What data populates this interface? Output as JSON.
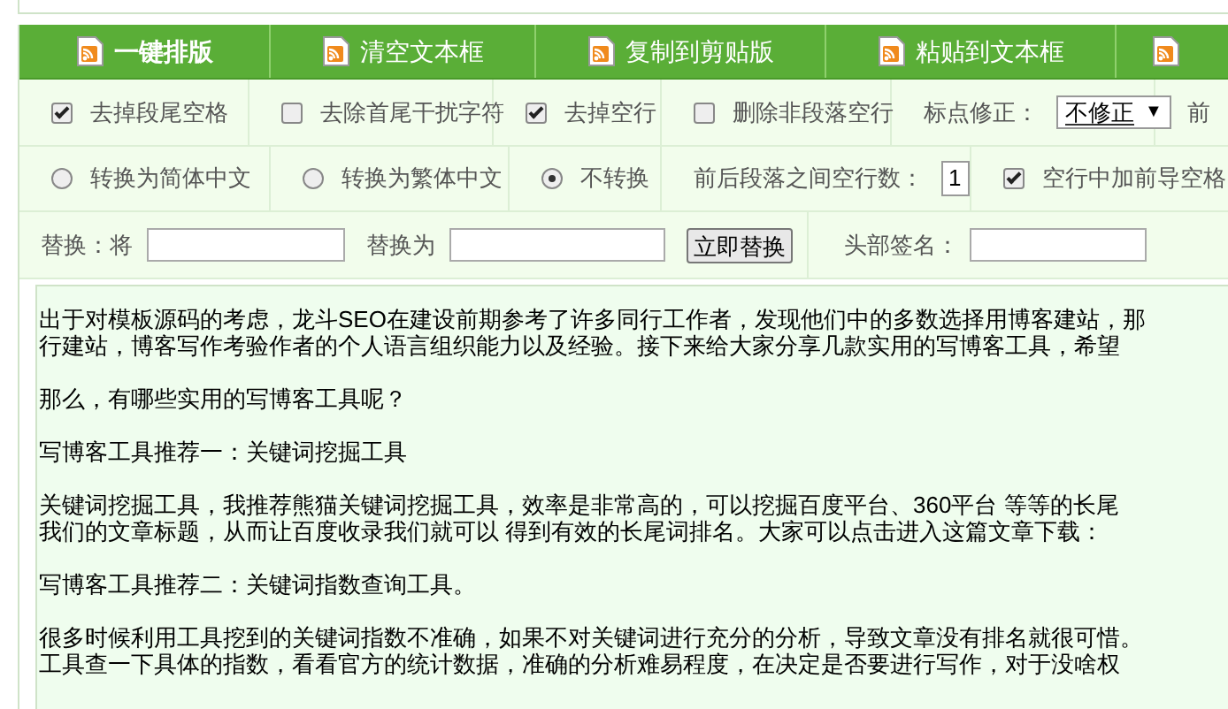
{
  "toolbar": [
    {
      "kind": "primary",
      "label": "一键排版"
    },
    {
      "kind": "normal",
      "label": "清空文本框"
    },
    {
      "kind": "normal",
      "label": "复制到剪贴版"
    },
    {
      "kind": "normal",
      "label": "粘贴到文本框"
    },
    {
      "kind": "icon_only"
    }
  ],
  "options_row": [
    {
      "kind": "checkbox",
      "label": "去掉段尾空格",
      "checked": true
    },
    {
      "kind": "checkbox",
      "label": "去除首尾干扰字符",
      "checked": false
    },
    {
      "kind": "checkbox",
      "label": "去掉空行",
      "checked": true
    },
    {
      "kind": "checkbox",
      "label": "删除非段落空行",
      "checked": false
    },
    {
      "kind": "select",
      "label": "标点修正：",
      "value": "不修正",
      "arrow": "▼"
    },
    {
      "kind": "text",
      "label": "前"
    }
  ],
  "convert_row": [
    {
      "kind": "radio",
      "label": "转换为简体中文",
      "selected": false
    },
    {
      "kind": "radio",
      "label": "转换为繁体中文",
      "selected": false
    },
    {
      "kind": "radio",
      "label": "不转换",
      "selected": true
    },
    {
      "kind": "number",
      "label": "前后段落之间空行数：",
      "value": "1"
    },
    {
      "kind": "checkbox",
      "label": "空行中加前导空格",
      "checked": true
    }
  ],
  "replace_row": {
    "find_label": "替换：将",
    "replace_label": "替换为",
    "button": "立即替换",
    "signature_label": "头部签名："
  },
  "text": [
    {
      "lines": [
        "出于对模板源码的考虑，龙斗SEO在建设前期参考了许多同行工作者，发现他们中的多数选择用博客建站，那",
        "行建站，博客写作考验作者的个人语言组织能力以及经验。接下来给大家分享几款实用的写博客工具，希望"
      ]
    },
    {
      "lines": [
        "那么，有哪些实用的写博客工具呢？"
      ]
    },
    {
      "lines": [
        "写博客工具推荐一：关键词挖掘工具"
      ]
    },
    {
      "lines": [
        "关键词挖掘工具，我推荐熊猫关键词挖掘工具，效率是非常高的，可以挖掘百度平台、360平台 等等的长尾",
        "我们的文章标题，从而让百度收录我们就可以 得到有效的长尾词排名。大家可以点击进入这篇文章下载："
      ]
    },
    {
      "lines": [
        "写博客工具推荐二：关键词指数查询工具。"
      ]
    },
    {
      "lines": [
        "很多时候利用工具挖到的关键词指数不准确，如果不对关键词进行充分的分析，导致文章没有排名就很可惜。",
        "工具查一下具体的指数，看看官方的统计数据，准确的分析难易程度，在决定是否要进行写作，对于没啥权"
      ]
    }
  ]
}
